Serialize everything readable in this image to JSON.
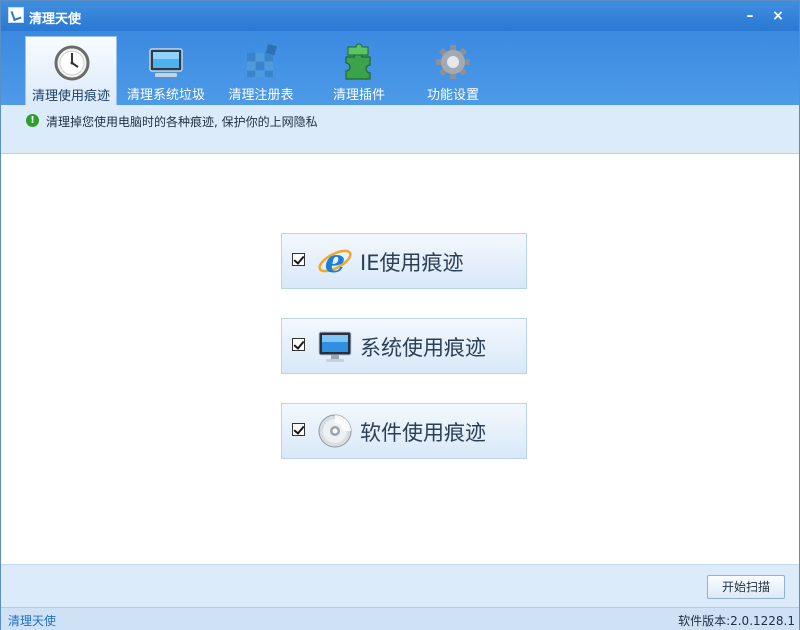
{
  "window": {
    "title": "清理天使",
    "minimize_glyph": "–",
    "close_glyph": "×"
  },
  "tabs": [
    {
      "label": "清理使用痕迹",
      "icon": "clock-icon",
      "active": true
    },
    {
      "label": "清理系统垃圾",
      "icon": "monitor-icon",
      "active": false
    },
    {
      "label": "清理注册表",
      "icon": "registry-grid-icon",
      "active": false
    },
    {
      "label": "清理插件",
      "icon": "puzzle-icon",
      "active": false
    },
    {
      "label": "功能设置",
      "icon": "gear-icon",
      "active": false
    }
  ],
  "info": {
    "icon": "info-icon",
    "text": "清理掉您使用电脑时的各种痕迹, 保护你的上网隐私"
  },
  "options": [
    {
      "label": "IE使用痕迹",
      "icon": "ie-icon",
      "checked": true
    },
    {
      "label": "系统使用痕迹",
      "icon": "monitor-icon",
      "checked": true
    },
    {
      "label": "软件使用痕迹",
      "icon": "disc-icon",
      "checked": true
    }
  ],
  "actions": {
    "scan_label": "开始扫描"
  },
  "statusbar": {
    "left": "清理天使",
    "right": "软件版本:2.0.1228.1"
  },
  "colors": {
    "titlebar": "#2a78d2",
    "accent": "#1f6fc8",
    "panel": "#dcebfa"
  }
}
